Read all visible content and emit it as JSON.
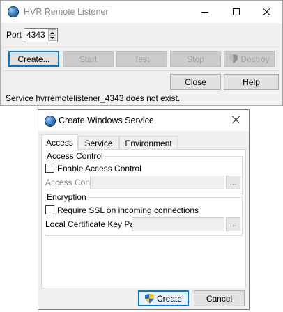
{
  "main_window": {
    "title": "HVR Remote Listener",
    "port_label": "Port",
    "port_value": "4343",
    "buttons": {
      "create": "Create...",
      "start": "Start",
      "test": "Test",
      "stop": "Stop",
      "destroy": "Destroy",
      "close": "Close",
      "help": "Help"
    },
    "status_text": "Service hvrremotelistener_4343 does not exist."
  },
  "dialog": {
    "title": "Create Windows Service",
    "tabs": [
      "Access",
      "Service",
      "Environment"
    ],
    "active_tab": "Access",
    "access_control": {
      "group_label": "Access Control",
      "checkbox_label": "Enable Access Control",
      "checked": false,
      "conf_label": "Access Conf",
      "conf_value": ""
    },
    "encryption": {
      "group_label": "Encryption",
      "checkbox_label": "Require SSL on incoming connections",
      "checked": false,
      "keypair_label": "Local Certificate Key Pair",
      "keypair_value": ""
    },
    "browse_label": "...",
    "buttons": {
      "create": "Create",
      "cancel": "Cancel"
    }
  },
  "icons": {
    "app": "hvr-globe-icon",
    "shield": "uac-shield-icon"
  },
  "colors": {
    "focus_blue": "#0078d7",
    "disabled_text": "#a0a0a0"
  }
}
